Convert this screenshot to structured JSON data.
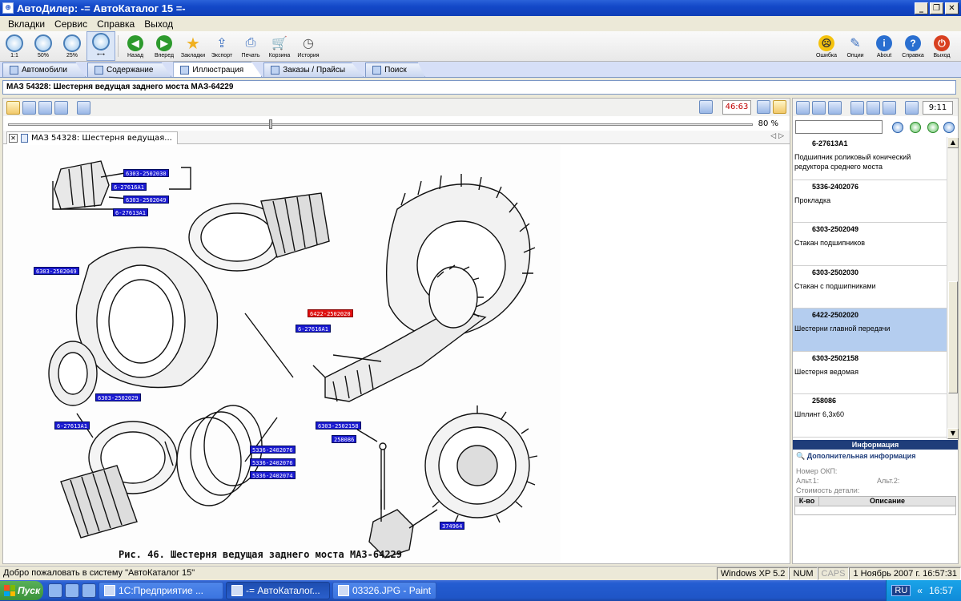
{
  "window": {
    "title": "АвтоДилер: -= АвтоКаталог 15 =-"
  },
  "menu": [
    "Вкладки",
    "Сервис",
    "Справка",
    "Выход"
  ],
  "toolbar": {
    "zoom": [
      "1:1",
      "50%",
      "25%",
      ""
    ],
    "nav": [
      {
        "label": "Назад",
        "icon": "back-arrow-icon"
      },
      {
        "label": "Вперед",
        "icon": "forward-arrow-icon"
      },
      {
        "label": "Закладки",
        "icon": "star-icon"
      },
      {
        "label": "Экспорт",
        "icon": "export-icon"
      },
      {
        "label": "Печать",
        "icon": "printer-icon"
      },
      {
        "label": "Корзина",
        "icon": "cart-icon"
      },
      {
        "label": "История",
        "icon": "history-icon"
      }
    ],
    "right": [
      {
        "label": "Ошибка",
        "icon": "smiley-icon"
      },
      {
        "label": "Опции",
        "icon": "options-icon"
      },
      {
        "label": "About",
        "icon": "info-icon"
      },
      {
        "label": "Справка",
        "icon": "help-icon"
      },
      {
        "label": "Выход",
        "icon": "power-icon"
      }
    ]
  },
  "tabs": [
    "Автомобили",
    "Содержание",
    "Иллюстрация",
    "Заказы / Прайсы",
    "Поиск"
  ],
  "breadcrumb": "МАЗ 54328: Шестерня ведущая заднего моста МАЗ-64229",
  "viewer": {
    "page_counter": "46:63",
    "zoom_percent": "80 %",
    "zoom_fraction": 0.35,
    "doc_tab": "МАЗ 54328: Шестерня ведущая...",
    "caption": "Рис. 46. Шестерня ведущая заднего моста МАЗ-64229",
    "callouts": [
      {
        "text": "6303-2502030",
        "selected": false
      },
      {
        "text": "6-27616А1",
        "selected": false
      },
      {
        "text": "6303-2502049",
        "selected": false
      },
      {
        "text": "6-27613А1",
        "selected": false
      },
      {
        "text": "6303-2502049",
        "selected": false
      },
      {
        "text": "6422-2502020",
        "selected": true
      },
      {
        "text": "6-27616А1",
        "selected": false
      },
      {
        "text": "6303-2502029",
        "selected": false
      },
      {
        "text": "6-27613А1",
        "selected": false
      },
      {
        "text": "6303-2502158",
        "selected": false
      },
      {
        "text": "258086",
        "selected": false
      },
      {
        "text": "5336-2402076",
        "selected": false
      },
      {
        "text": "5336-2402076",
        "selected": false
      },
      {
        "text": "5336-2402074",
        "selected": false
      },
      {
        "text": "374964",
        "selected": false
      }
    ]
  },
  "right_panel": {
    "time": "9:11",
    "parts": [
      {
        "number": "6-27613А1",
        "name": "Подшипник роликовый конический редуктора среднего моста",
        "selected": false
      },
      {
        "number": "5336-2402076",
        "name": "Прокладка",
        "selected": false
      },
      {
        "number": "6303-2502049",
        "name": "Стакан подшипников",
        "selected": false
      },
      {
        "number": "6303-2502030",
        "name": "Стакан с подшипниками",
        "selected": false
      },
      {
        "number": "6422-2502020",
        "name": "Шестерни главной передачи",
        "selected": true
      },
      {
        "number": "6303-2502158",
        "name": "Шестерня ведомая",
        "selected": false
      },
      {
        "number": "258086",
        "name": "Шплинт 6,3х60",
        "selected": false
      }
    ],
    "info_header": "Информация",
    "additional_info": "Дополнительная информация",
    "okp_label": "Номер ОКП:",
    "alt1_label": "Альт.1:",
    "alt2_label": "Альт.2:",
    "cost_label": "Стоимость детали:",
    "table_headers": [
      "К-во",
      "Описание"
    ]
  },
  "status": {
    "message": "Добро пожаловать в систему \"АвтоКаталог 15\"",
    "os": "Windows XP 5.2",
    "num": "NUM",
    "caps": "CAPS",
    "datetime": "1 Ноябрь 2007 г. 16:57:31"
  },
  "taskbar": {
    "start": "Пуск",
    "buttons": [
      {
        "label": "1С:Предприятие ...",
        "active": false
      },
      {
        "label": "-= АвтоКаталог...",
        "active": true
      },
      {
        "label": "03326.JPG - Paint",
        "active": false
      }
    ],
    "lang": "RU",
    "clock": "16:57"
  }
}
